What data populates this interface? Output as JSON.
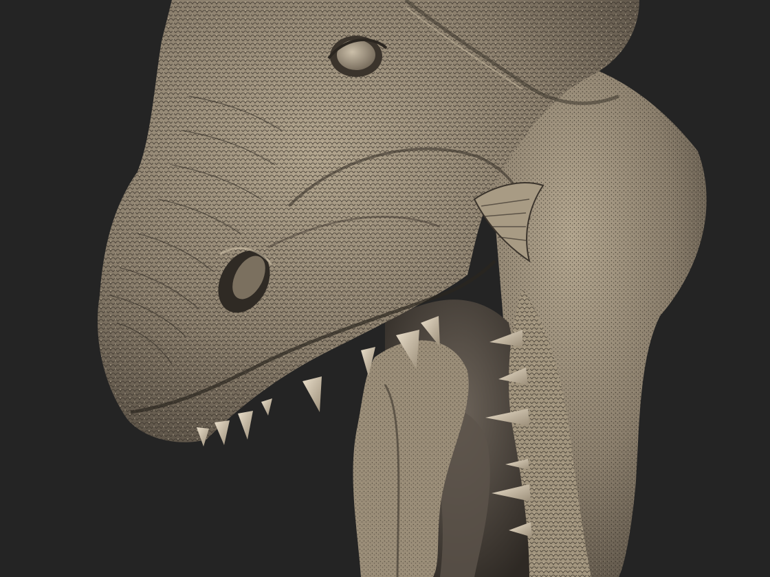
{
  "scene": {
    "subject": "creature-head-sculpt",
    "background_color": "#242424",
    "material_base_color": "#8a7e6c",
    "material_highlight_color": "#c9bba3",
    "material_shadow_color": "#3b342c",
    "tooth_color": "#d8cab2",
    "mouth_interior_color": "#4a423a"
  }
}
